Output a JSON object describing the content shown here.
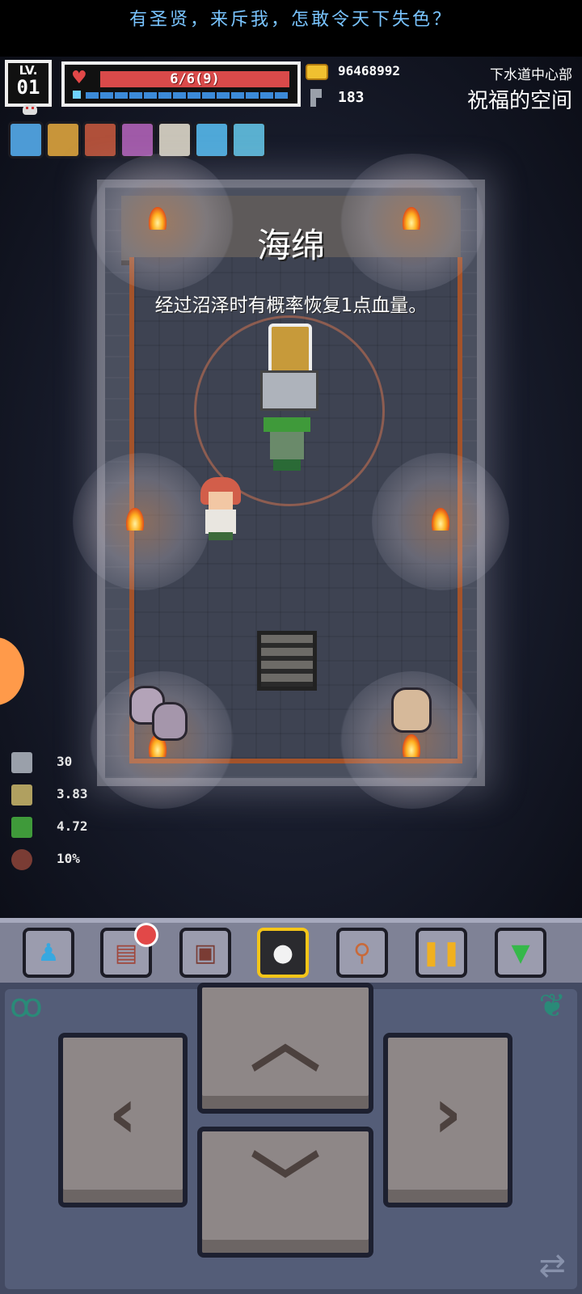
{
  "banner": {
    "text": "有圣贤，来斥我，怎敢令天下失色？"
  },
  "hud": {
    "level_label": "LV.",
    "level": "01",
    "hp_text": "6/6(9)",
    "coins": "96468992",
    "gems": "183",
    "location_area": "下水道中心部",
    "location_room": "祝福的空间"
  },
  "buffs": [
    {
      "icon": "crystal-orb-icon",
      "color": "#4d9bd6"
    },
    {
      "icon": "sponge-icon",
      "color": "#c8953a"
    },
    {
      "icon": "berry-basket-icon",
      "color": "#b0503a"
    },
    {
      "icon": "potion-icon",
      "color": "#a05aa8"
    },
    {
      "icon": "boot-icon",
      "color": "#c9c4b8"
    },
    {
      "icon": "funnel-icon",
      "color": "#4fa8d8"
    },
    {
      "icon": "cross-rune-icon",
      "color": "#5ab0d0"
    }
  ],
  "item": {
    "title": "海绵",
    "description": "经过沼泽时有概率恢复1点血量。"
  },
  "stats": [
    {
      "icon": "attack-icon",
      "value": "30"
    },
    {
      "icon": "attack-speed-icon",
      "value": "3.83"
    },
    {
      "icon": "move-speed-icon",
      "value": "4.72"
    },
    {
      "icon": "defense-icon",
      "value": "10%"
    }
  ],
  "toolbar": [
    {
      "name": "character-button",
      "icon": "character-icon",
      "glyph": "♟",
      "color": "#37a8e0"
    },
    {
      "name": "journal-button",
      "icon": "journal-icon",
      "glyph": "▤",
      "color": "#a0473c",
      "badge": true
    },
    {
      "name": "inventory-button",
      "icon": "bag-icon",
      "glyph": "▣",
      "color": "#7a3c34"
    },
    {
      "name": "target-button",
      "icon": "target-icon",
      "glyph": "●",
      "color": "#f2f2f2",
      "active": true
    },
    {
      "name": "search-button",
      "icon": "search-icon",
      "glyph": "⚲",
      "color": "#c86a3a"
    },
    {
      "name": "pause-button",
      "icon": "pause-icon",
      "glyph": "❚❚",
      "color": "#f0b020"
    },
    {
      "name": "collapse-button",
      "icon": "chevron-down-icon",
      "glyph": "▼",
      "color": "#35b84a"
    }
  ],
  "dpad": {
    "up": "︿",
    "down": "﹀",
    "left": "‹",
    "right": "›",
    "swap": "⇄"
  },
  "colors": {
    "accent_hp": "#d94a4a",
    "accent_mp": "#3c8ad8",
    "highlight": "#f5c518"
  }
}
